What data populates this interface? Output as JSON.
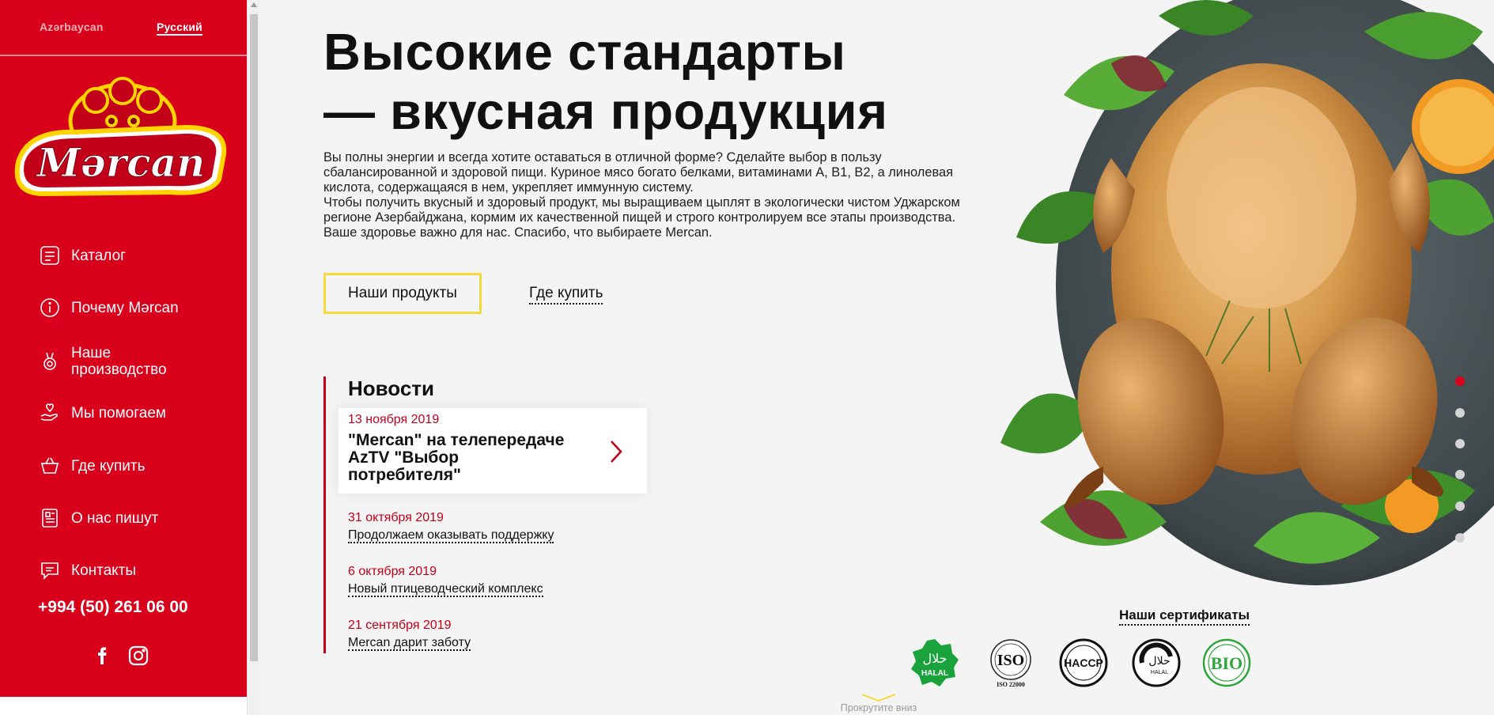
{
  "sidebar": {
    "languages": [
      {
        "label": "Azərbaycan",
        "active": false
      },
      {
        "label": "Русский",
        "active": true
      }
    ],
    "logo_text": "Mərcan",
    "nav": [
      {
        "label": "Каталог",
        "icon": "catalog-icon"
      },
      {
        "label": "Почему Mərcan",
        "icon": "info-icon"
      },
      {
        "label": "Наше производство",
        "icon": "medal-icon"
      },
      {
        "label": "Мы помогаем",
        "icon": "helping-hand-icon"
      },
      {
        "label": "Где купить",
        "icon": "basket-icon"
      },
      {
        "label": "О нас пишут",
        "icon": "newspaper-icon"
      },
      {
        "label": "Контакты",
        "icon": "chat-icon"
      }
    ],
    "phone": "+994 (50) 261 06 00",
    "social": [
      "facebook-icon",
      "instagram-icon"
    ]
  },
  "hero": {
    "title_line1": "Высокие стандарты",
    "title_line2": "— вкусная продукция",
    "paragraph1": "Вы полны энергии и всегда хотите оставаться в отличной форме? Сделайте выбор в пользу сбалансированной и здоровой пищи. Куриное мясо богато белками, витаминами A, B1, B2, a линолевая кислота, содержащаяся в нем, укрепляет иммунную систему.",
    "paragraph2": "Чтобы получить вкусный и здоровый продукт, мы выращиваем цыплят в экологически чистом Уджарском регионе Азербайджана, кормим их качественной пищей и строго контролируем все этапы производства. Ваше здоровье важно для нас. Спасибо, что выбираете Mercan.",
    "button_products": "Наши продукты",
    "link_where_to_buy": "Где купить"
  },
  "news": {
    "title": "Новости",
    "featured": {
      "date": "13 ноября 2019",
      "headline": "\"Mercan\" на телепередаче AzTV \"Выбор потребителя\""
    },
    "items": [
      {
        "date": "31 октября 2019",
        "text": "Продолжаем оказывать поддержку"
      },
      {
        "date": "6 октября 2019",
        "text": "Новый птицеводческий комплекс"
      },
      {
        "date": "21 сентября 2019",
        "text": "Mercan дарит заботу"
      }
    ]
  },
  "slider": {
    "total_slides": 6,
    "active_slide": 1
  },
  "certificates": {
    "title": "Наши сертификаты",
    "items": [
      {
        "name": "halal-green",
        "text": "HALAL",
        "arabic": "حلال"
      },
      {
        "name": "iso",
        "text": "ISO",
        "sub": "ISO 22000"
      },
      {
        "name": "haccp",
        "text": "HACCP"
      },
      {
        "name": "halal-black",
        "text": "HALAL",
        "arabic": "حلال"
      },
      {
        "name": "bio",
        "text": "BIO"
      }
    ]
  },
  "scroll_hint": "Прокрутите вниз",
  "colors": {
    "brand_red": "#d9001b",
    "accent_yellow": "#f3d93a",
    "news_red": "#c2001a",
    "halal_green": "#1aa33c"
  }
}
